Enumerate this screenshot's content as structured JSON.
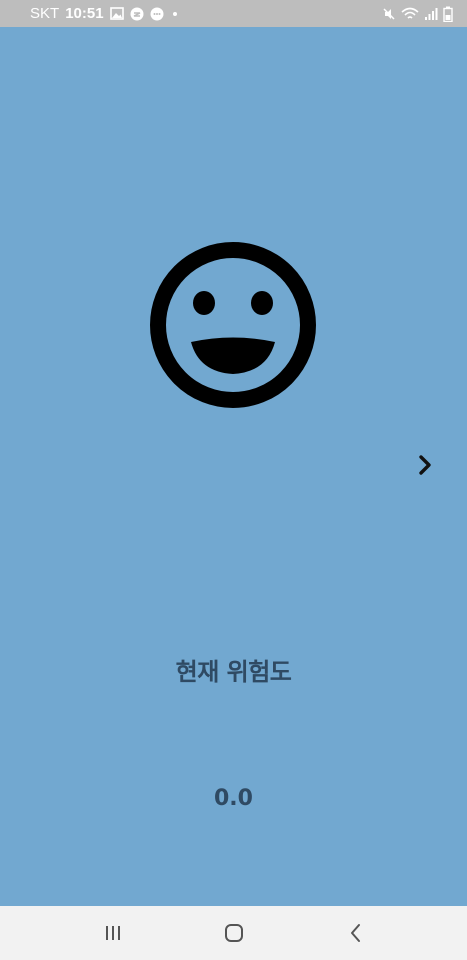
{
  "status_bar": {
    "carrier": "SKT",
    "time": "10:51",
    "notification_icons": [
      "gallery-icon",
      "messenger-icon",
      "chat-icon",
      "dot-icon"
    ],
    "system_icons": [
      "mute-icon",
      "wifi-icon",
      "signal-icon",
      "battery-icon"
    ]
  },
  "main": {
    "status_face_icon": "smiley-face-icon",
    "next_icon": "chevron-right-icon",
    "risk_label": "현재 위험도",
    "risk_value": "0.0",
    "background_color": "#72a8d0",
    "text_color": "#2f4a63"
  },
  "nav_bar": {
    "recent_icon": "recent-apps-icon",
    "home_icon": "home-icon",
    "back_icon": "back-icon"
  }
}
